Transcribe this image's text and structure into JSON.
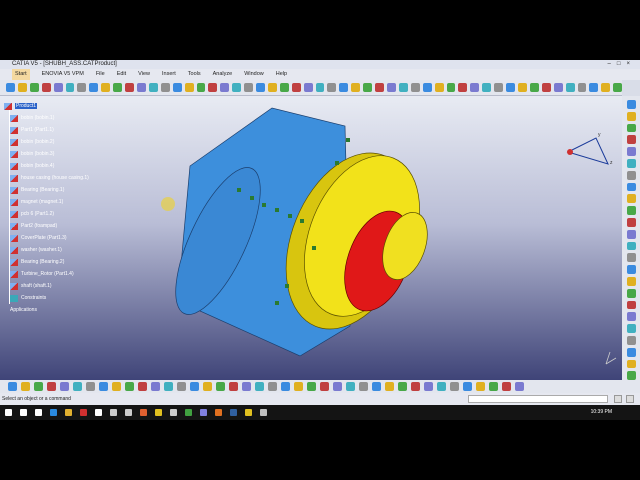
{
  "window": {
    "title": "CATIA V5 - [SHUBH_ASS.CATProduct]"
  },
  "menu": [
    "Start",
    "ENOVIA V5 VPM",
    "File",
    "Edit",
    "View",
    "Insert",
    "Tools",
    "Analyze",
    "Window",
    "Help"
  ],
  "tree": {
    "root": "Product1",
    "items": [
      "bobin (bobin.1)",
      "Part1 (Part1.1)",
      "bobin (bobin.2)",
      "bobin (bobin.3)",
      "bobin (bobin.4)",
      "house casing (house casing.1)",
      "Bearing (Bearing.1)",
      "magnet (magnet.1)",
      "pcb 6 (Part1.2)",
      "Part2 (foampad)",
      "CoverPlate (Part1.3)",
      "washer (washer.1)",
      "Bearing (Bearing.2)",
      "Turbine_Rotor (Part1.4)",
      "shaft (shaft.1)"
    ],
    "constraints": "Constraints",
    "applications": "Applications"
  },
  "status": {
    "message": "Select an object or a command"
  },
  "taskbar": {
    "time": "10:39 PM"
  },
  "colors": {
    "casing": "#3d8fdc",
    "plate": "#f2e21a",
    "rotor": "#e01818"
  }
}
